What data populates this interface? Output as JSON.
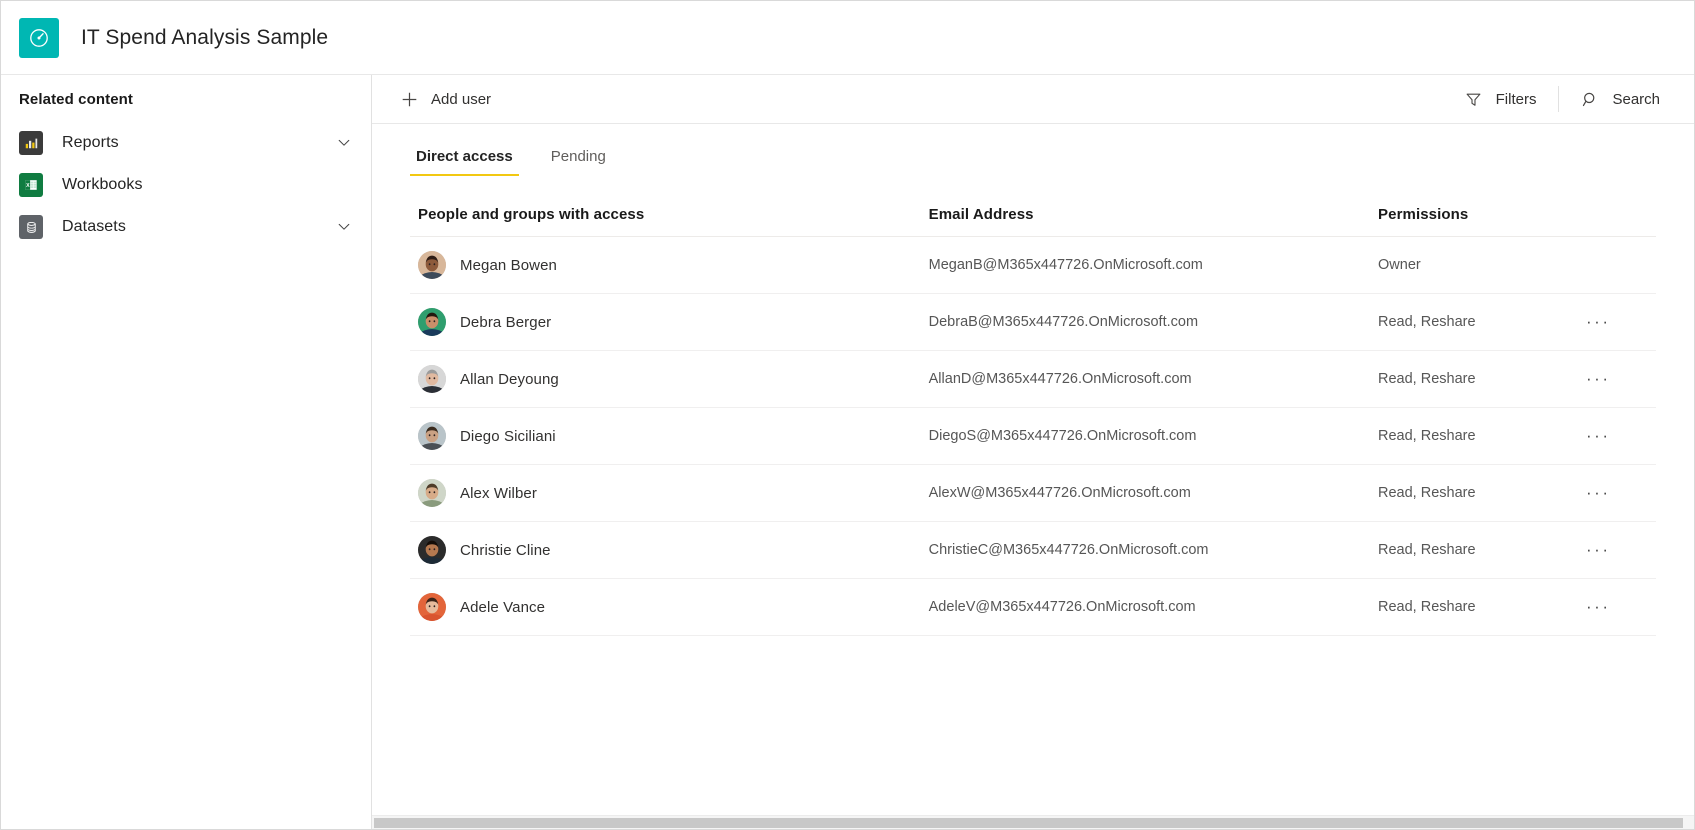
{
  "header": {
    "title": "IT Spend Analysis Sample",
    "logo_icon": "gauge-icon",
    "logo_color": "#00b7b3"
  },
  "sidebar": {
    "title": "Related content",
    "items": [
      {
        "label": "Reports",
        "icon": "bar-chart-icon",
        "icon_color": "#3b3b3b",
        "expandable": true
      },
      {
        "label": "Workbooks",
        "icon": "excel-workbook-icon",
        "icon_color": "#107c41",
        "expandable": false
      },
      {
        "label": "Datasets",
        "icon": "database-icon",
        "icon_color": "#5f6368",
        "expandable": true
      }
    ]
  },
  "command_bar": {
    "add_user_label": "Add user",
    "add_user_icon": "plus-icon",
    "filters_label": "Filters",
    "filters_icon": "filter-icon",
    "search_label": "Search",
    "search_icon": "search-icon"
  },
  "tabs": [
    {
      "label": "Direct access",
      "active": true
    },
    {
      "label": "Pending",
      "active": false
    }
  ],
  "table": {
    "columns": [
      "People and groups with access",
      "Email Address",
      "Permissions",
      ""
    ],
    "menu_glyph": "···",
    "rows": [
      {
        "name": "Megan Bowen",
        "email": "MeganB@M365x447726.OnMicrosoft.com",
        "permission": "Owner",
        "has_menu": false,
        "avatar": {
          "skin": "#8d5a3b",
          "hair": "#2e1c14",
          "bg": "#d8b79a",
          "shirt": "#3c4a5a"
        }
      },
      {
        "name": "Debra Berger",
        "email": "DebraB@M365x447726.OnMicrosoft.com",
        "permission": "Read, Reshare",
        "has_menu": true,
        "avatar": {
          "skin": "#c98f6a",
          "hair": "#23180f",
          "bg": "#2f9e6e",
          "shirt": "#1a3b5c"
        }
      },
      {
        "name": "Allan Deyoung",
        "email": "AllanD@M365x447726.OnMicrosoft.com",
        "permission": "Read, Reshare",
        "has_menu": true,
        "avatar": {
          "skin": "#e0b9a0",
          "hair": "#9b9b9b",
          "bg": "#d7d7d7",
          "shirt": "#2b2f36"
        }
      },
      {
        "name": "Diego Siciliani",
        "email": "DiegoS@M365x447726.OnMicrosoft.com",
        "permission": "Read, Reshare",
        "has_menu": true,
        "avatar": {
          "skin": "#caa183",
          "hair": "#3a2a1d",
          "bg": "#b9c4c9",
          "shirt": "#4a4f55"
        }
      },
      {
        "name": "Alex Wilber",
        "email": "AlexW@M365x447726.OnMicrosoft.com",
        "permission": "Read, Reshare",
        "has_menu": true,
        "avatar": {
          "skin": "#d7ab88",
          "hair": "#4d3b28",
          "bg": "#cfd6c8",
          "shirt": "#8a9b7d"
        }
      },
      {
        "name": "Christie Cline",
        "email": "ChristieC@M365x447726.OnMicrosoft.com",
        "permission": "Read, Reshare",
        "has_menu": true,
        "avatar": {
          "skin": "#b4784f",
          "hair": "#140d08",
          "bg": "#2b2b2b",
          "shirt": "#1d2a36"
        }
      },
      {
        "name": "Adele Vance",
        "email": "AdeleV@M365x447726.OnMicrosoft.com",
        "permission": "Read, Reshare",
        "has_menu": true,
        "avatar": {
          "skin": "#e6bb9c",
          "hair": "#3b2418",
          "bg": "#e3653a",
          "shirt": "#d9542f"
        }
      }
    ]
  }
}
